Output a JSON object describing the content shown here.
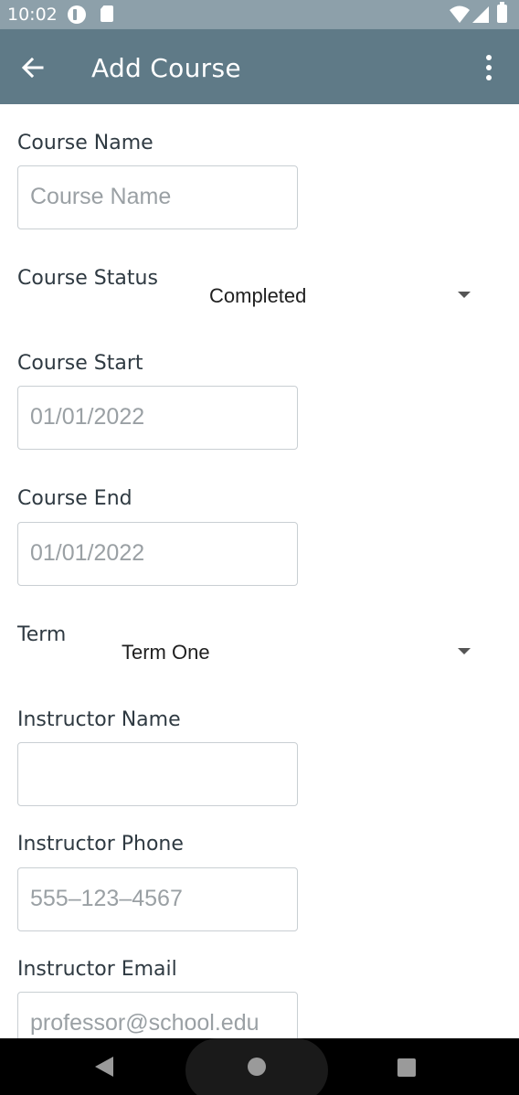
{
  "status_bar": {
    "time": "10:02",
    "icons": [
      "notification-circle-icon",
      "sd-card-icon",
      "wifi-icon",
      "signal-icon",
      "battery-icon"
    ]
  },
  "app_bar": {
    "title": "Add Course",
    "back_icon": "arrow-left-icon",
    "menu_icon": "more-vertical-icon"
  },
  "form": {
    "course_name": {
      "label": "Course Name",
      "value": "",
      "placeholder": "Course Name"
    },
    "course_status": {
      "label": "Course Status",
      "selected": "Completed"
    },
    "course_start": {
      "label": "Course Start",
      "value": "",
      "placeholder": "01/01/2022"
    },
    "course_end": {
      "label": "Course End",
      "value": "",
      "placeholder": "01/01/2022"
    },
    "term": {
      "label": "Term",
      "selected": "Term One"
    },
    "instructor_name": {
      "label": "Instructor Name",
      "value": "",
      "placeholder": ""
    },
    "instructor_phone": {
      "label": "Instructor Phone",
      "value": "",
      "placeholder": "555–123–4567"
    },
    "instructor_email": {
      "label": "Instructor Email",
      "value": "",
      "placeholder": "professor@school.edu"
    }
  },
  "nav_bar": {
    "icons": [
      "nav-back-icon",
      "nav-home-icon",
      "nav-recents-icon"
    ]
  },
  "colors": {
    "status_bar": "#8da0aa",
    "app_bar": "#5f7a87",
    "label_text": "#2f3a42",
    "field_border": "#c9cfd3",
    "placeholder": "#9aa0a4"
  }
}
